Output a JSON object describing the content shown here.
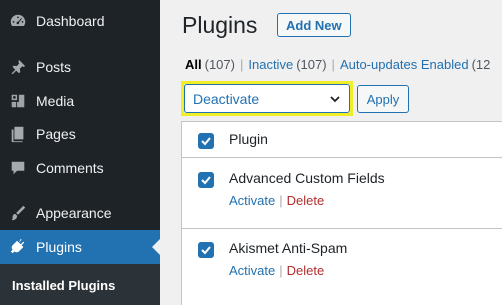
{
  "sidebar": {
    "items": [
      {
        "label": "Dashboard",
        "icon": "dashboard-icon"
      },
      {
        "label": "Posts",
        "icon": "pin-icon"
      },
      {
        "label": "Media",
        "icon": "media-icon"
      },
      {
        "label": "Pages",
        "icon": "pages-icon"
      },
      {
        "label": "Comments",
        "icon": "comment-icon"
      },
      {
        "label": "Appearance",
        "icon": "paintbrush-icon"
      },
      {
        "label": "Plugins",
        "icon": "plugin-icon"
      }
    ],
    "active_item": "Plugins",
    "submenu": {
      "label": "Installed Plugins"
    }
  },
  "header": {
    "title": "Plugins",
    "add_new_label": "Add New"
  },
  "filters": [
    {
      "label": "All",
      "count": "(107)"
    },
    {
      "label": "Inactive",
      "count": "(107)"
    },
    {
      "label": "Auto-updates Enabled",
      "count": "(12"
    }
  ],
  "bulk_action": {
    "selected": "Deactivate",
    "apply_label": "Apply"
  },
  "table": {
    "header_label": "Plugin",
    "rows": [
      {
        "name": "Advanced Custom Fields",
        "activate": "Activate",
        "delete": "Delete"
      },
      {
        "name": "Akismet Anti-Spam",
        "activate": "Activate",
        "delete": "Delete"
      }
    ]
  },
  "colors": {
    "sidebar_bg": "#1d2327",
    "accent": "#2271b1",
    "highlight": "#f0ee29",
    "delete": "#b32d2e"
  }
}
